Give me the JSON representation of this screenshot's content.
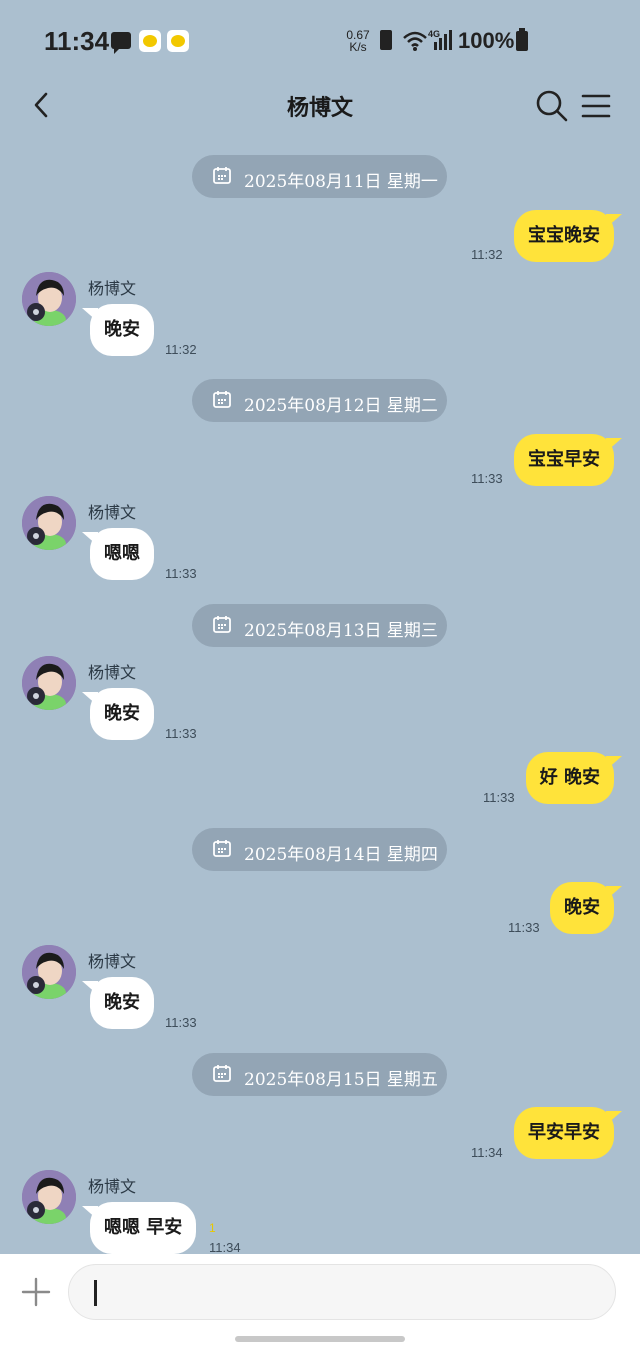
{
  "status_bar": {
    "time": "11:34",
    "net_speed_value": "0.67",
    "net_speed_unit": "K/s",
    "battery_pct": "100%",
    "network": "4G",
    "icons": [
      "message-icon",
      "app-notification-icon",
      "app-notification-icon",
      "battery-saver-icon",
      "wifi-icon",
      "signal-icon",
      "battery-icon"
    ]
  },
  "header": {
    "title": "杨博文",
    "icons": [
      "back-arrow-icon",
      "search-icon",
      "menu-icon"
    ]
  },
  "colors": {
    "background": "#abbfcf",
    "outgoing_bubble": "#ffe33a",
    "incoming_bubble": "#ffffff",
    "date_pill": "#93a5b5",
    "unread_count": "#e8c800"
  },
  "messages": [
    {
      "kind": "date",
      "text": "2025年08月11日  星期一"
    },
    {
      "kind": "out",
      "text": "宝宝晚安",
      "time": "11:32"
    },
    {
      "kind": "in",
      "sender": "杨博文",
      "text": "晚安",
      "time": "11:32"
    },
    {
      "kind": "date",
      "text": "2025年08月12日  星期二"
    },
    {
      "kind": "out",
      "text": "宝宝早安",
      "time": "11:33"
    },
    {
      "kind": "in",
      "sender": "杨博文",
      "text": "嗯嗯",
      "time": "11:33"
    },
    {
      "kind": "date",
      "text": "2025年08月13日  星期三"
    },
    {
      "kind": "in",
      "sender": "杨博文",
      "text": "晚安",
      "time": "11:33"
    },
    {
      "kind": "out",
      "text": "好 晚安",
      "time": "11:33"
    },
    {
      "kind": "date",
      "text": "2025年08月14日  星期四"
    },
    {
      "kind": "out",
      "text": "晚安",
      "time": "11:33"
    },
    {
      "kind": "in",
      "sender": "杨博文",
      "text": "晚安",
      "time": "11:33"
    },
    {
      "kind": "date",
      "text": "2025年08月15日  星期五"
    },
    {
      "kind": "out",
      "text": "早安早安",
      "time": "11:34"
    },
    {
      "kind": "in",
      "sender": "杨博文",
      "text": "嗯嗯 早安",
      "time": "11:34",
      "unread": "1"
    }
  ],
  "input_bar": {
    "placeholder": "",
    "value": "",
    "icons": [
      "plus-icon",
      "emoji-icon"
    ]
  }
}
